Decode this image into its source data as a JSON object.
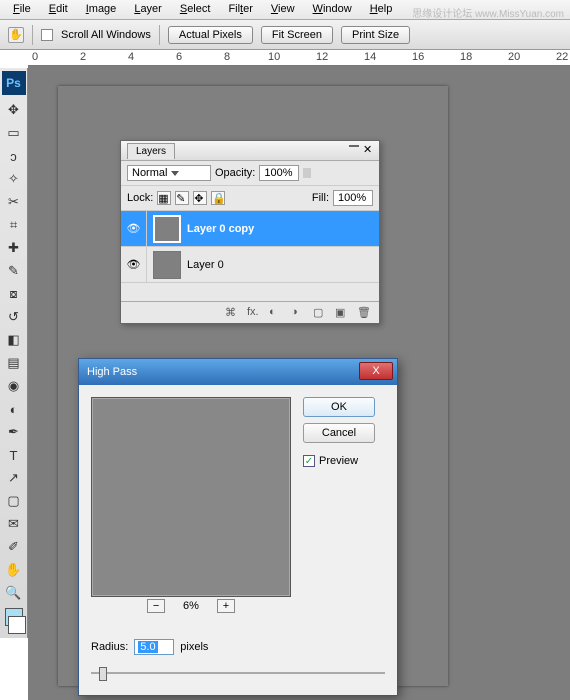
{
  "menu": {
    "file": "File",
    "edit": "Edit",
    "image": "Image",
    "layer": "Layer",
    "select": "Select",
    "filter": "Filter",
    "view": "View",
    "window": "Window",
    "help": "Help"
  },
  "watermark": "思缘设计论坛 www.MissYuan.com",
  "optbar": {
    "scroll_all": "Scroll All Windows",
    "actual": "Actual Pixels",
    "fit": "Fit Screen",
    "print": "Print Size"
  },
  "ruler": {
    "marks": [
      0,
      2,
      4,
      6,
      8,
      10,
      12,
      14,
      16,
      18,
      20,
      22
    ]
  },
  "layers_panel": {
    "tab": "Layers",
    "blend": "Normal",
    "opacity_label": "Opacity:",
    "opacity_val": "100%",
    "lock_label": "Lock:",
    "fill_label": "Fill:",
    "fill_val": "100%",
    "layers": [
      {
        "name": "Layer 0 copy",
        "selected": true
      },
      {
        "name": "Layer 0",
        "selected": false
      }
    ]
  },
  "dialog": {
    "title": "High Pass",
    "ok": "OK",
    "cancel": "Cancel",
    "preview": "Preview",
    "zoom_pct": "6%",
    "radius_label": "Radius:",
    "radius_val": "5.0",
    "radius_unit": "pixels"
  }
}
